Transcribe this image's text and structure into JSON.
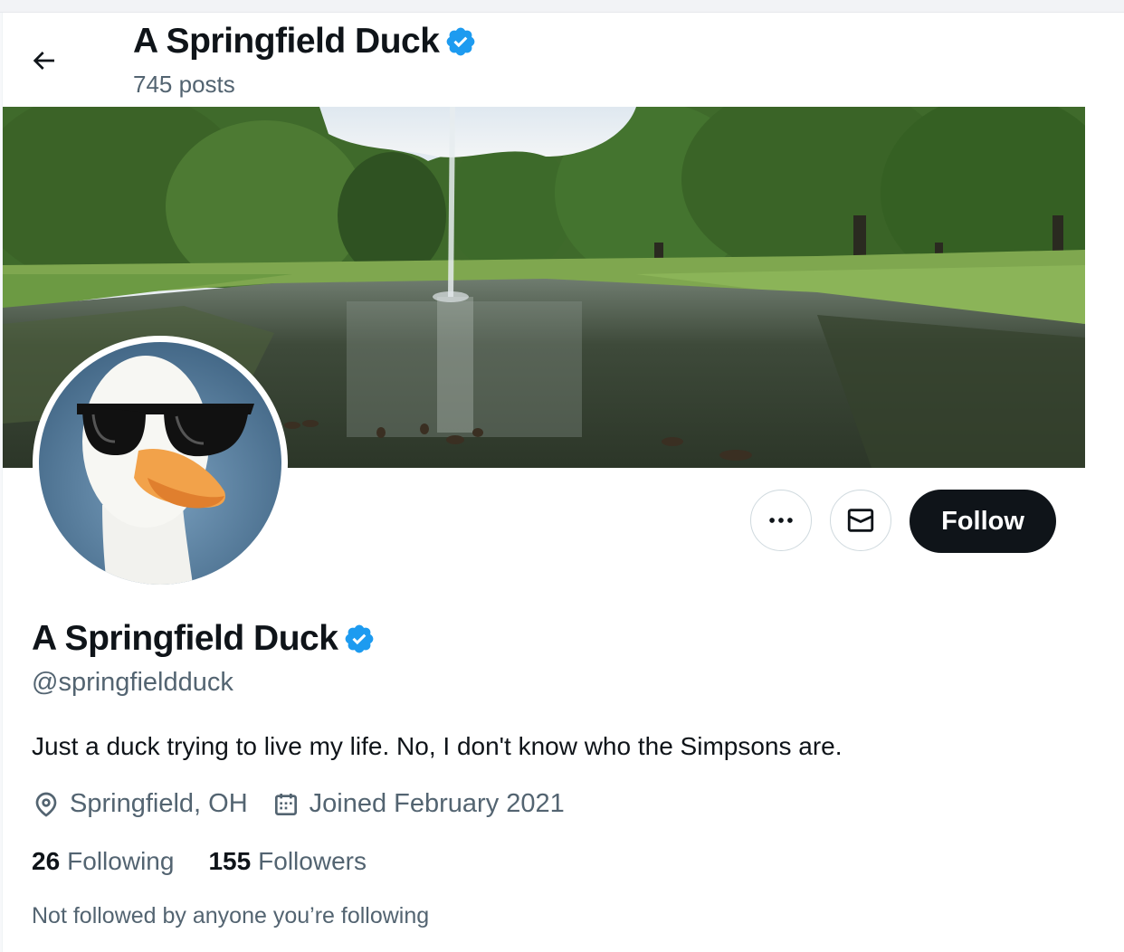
{
  "header": {
    "display_name": "A Springfield Duck",
    "posts_count": "745 posts"
  },
  "profile": {
    "display_name": "A Springfield Duck",
    "handle": "@springfieldduck",
    "bio": "Just a duck trying to live my life. No, I don't know who the Simpsons are.",
    "location": "Springfield, OH",
    "joined": "Joined February 2021",
    "following_count": "26",
    "following_label": "Following",
    "followers_count": "155",
    "followers_label": "Followers",
    "mutuals_note": "Not followed by anyone you’re following",
    "verified": true
  },
  "actions": {
    "more_icon": "more-horizontal-icon",
    "message_icon": "envelope-icon",
    "follow_label": "Follow"
  },
  "icons": {
    "back": "arrow-left-icon",
    "verified": "verified-badge-icon",
    "location": "map-pin-icon",
    "calendar": "calendar-icon"
  },
  "colors": {
    "verified_blue": "#1d9bf0",
    "follow_button_bg": "#0f1419",
    "secondary_text": "#536471"
  }
}
